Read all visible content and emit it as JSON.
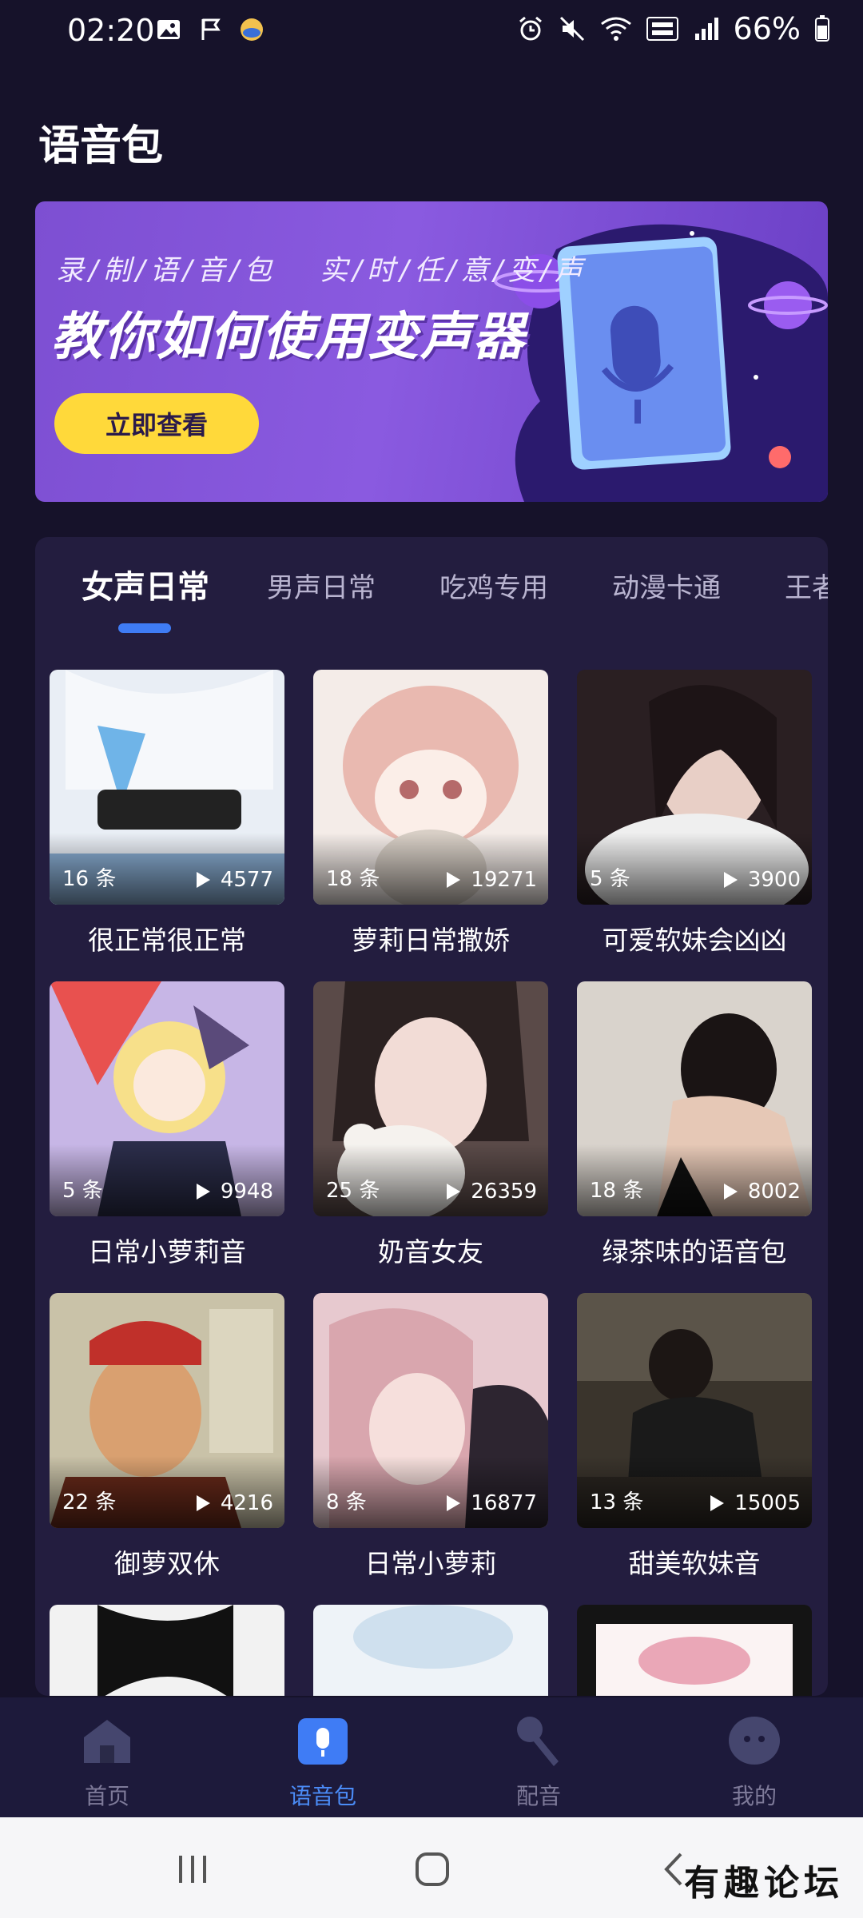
{
  "status_bar": {
    "time": "02:20",
    "battery": "66%"
  },
  "page": {
    "title": "语音包"
  },
  "banner": {
    "subtitle_left": "录/制/语/音/包",
    "subtitle_right": "实/时/任/意/变/声",
    "headline": "教你如何使用变声器",
    "cta_label": "立即查看"
  },
  "tabs": [
    {
      "label": "女声日常",
      "active": true
    },
    {
      "label": "男声日常"
    },
    {
      "label": "吃鸡专用"
    },
    {
      "label": "动漫卡通"
    },
    {
      "label": "王者"
    }
  ],
  "items": [
    {
      "title": "很正常很正常",
      "count": "16 条",
      "plays": "4577"
    },
    {
      "title": "萝莉日常撒娇",
      "count": "18 条",
      "plays": "19271"
    },
    {
      "title": "可爱软妹会凶凶",
      "count": "5 条",
      "plays": "3900"
    },
    {
      "title": "日常小萝莉音",
      "count": "5 条",
      "plays": "9948"
    },
    {
      "title": "奶音女友",
      "count": "25 条",
      "plays": "26359"
    },
    {
      "title": "绿茶味的语音包",
      "count": "18 条",
      "plays": "8002"
    },
    {
      "title": "御萝双休",
      "count": "22 条",
      "plays": "4216"
    },
    {
      "title": "日常小萝莉",
      "count": "8 条",
      "plays": "16877"
    },
    {
      "title": "甜美软妹音",
      "count": "13 条",
      "plays": "15005"
    }
  ],
  "bottom_nav": [
    {
      "label": "首页",
      "icon": "home-icon"
    },
    {
      "label": "语音包",
      "icon": "voice-pack-icon",
      "active": true
    },
    {
      "label": "配音",
      "icon": "microphone-icon"
    },
    {
      "label": "我的",
      "icon": "profile-icon"
    }
  ],
  "watermark": "有趣论坛",
  "colors": {
    "accent": "#3f7cf5",
    "background": "#16122a",
    "card": "#231d3f",
    "cta": "#ffd93a"
  }
}
